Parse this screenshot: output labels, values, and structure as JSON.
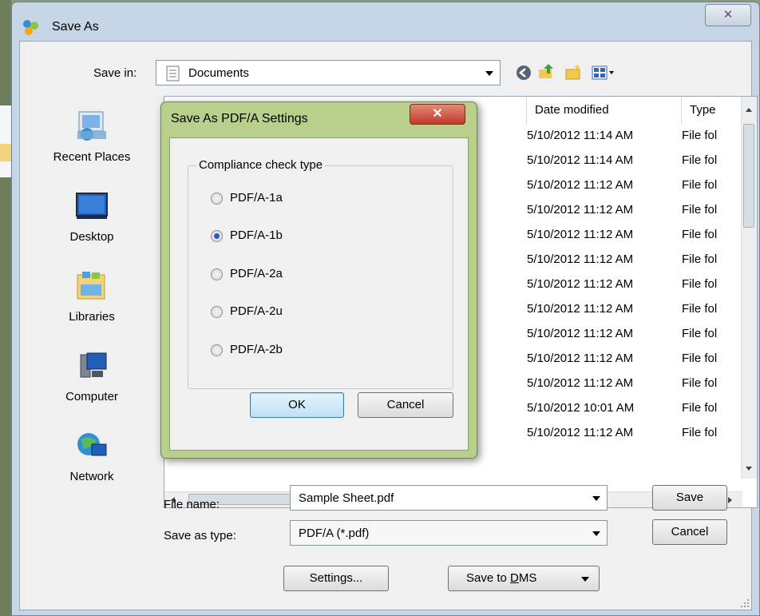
{
  "window": {
    "title": "Save As",
    "close_glyph": "✕"
  },
  "toolbar": {
    "save_in_label": "Save in:",
    "save_in_value": "Documents",
    "icons": [
      "back-icon",
      "up-folder-icon",
      "new-folder-icon",
      "view-menu-icon"
    ]
  },
  "places": [
    {
      "label": "Recent Places",
      "icon": "recent-places-icon"
    },
    {
      "label": "Desktop",
      "icon": "desktop-icon"
    },
    {
      "label": "Libraries",
      "icon": "libraries-icon"
    },
    {
      "label": "Computer",
      "icon": "computer-icon"
    },
    {
      "label": "Network",
      "icon": "network-icon"
    }
  ],
  "file_list": {
    "columns": [
      "Date modified",
      "Type"
    ],
    "rows": [
      {
        "date": "5/10/2012 11:14 AM",
        "type": "File fol"
      },
      {
        "date": "5/10/2012 11:14 AM",
        "type": "File fol"
      },
      {
        "date": "5/10/2012 11:12 AM",
        "type": "File fol"
      },
      {
        "date": "5/10/2012 11:12 AM",
        "type": "File fol"
      },
      {
        "date": "5/10/2012 11:12 AM",
        "type": "File fol"
      },
      {
        "date": "5/10/2012 11:12 AM",
        "type": "File fol"
      },
      {
        "date": "5/10/2012 11:12 AM",
        "type": "File fol"
      },
      {
        "date": "5/10/2012 11:12 AM",
        "type": "File fol"
      },
      {
        "date": "5/10/2012 11:12 AM",
        "type": "File fol"
      },
      {
        "date": "5/10/2012 11:12 AM",
        "type": "File fol"
      },
      {
        "date": "5/10/2012 11:12 AM",
        "type": "File fol"
      },
      {
        "date": "5/10/2012 10:01 AM",
        "type": "File fol"
      },
      {
        "date": "5/10/2012 11:12 AM",
        "type": "File fol"
      }
    ]
  },
  "form": {
    "file_name_label": "File name:",
    "file_name_value": "Sample Sheet.pdf",
    "save_type_label": "Save as type:",
    "save_type_value": "PDF/A (*.pdf)",
    "save_button": "Save",
    "cancel_button": "Cancel",
    "settings_button": "Settings...",
    "save_dms_prefix": "Save to ",
    "save_dms_accel": "D",
    "save_dms_rest": "MS"
  },
  "modal": {
    "title": "Save As PDF/A Settings",
    "close_glyph": "✕",
    "group_label": "Compliance check type",
    "options": [
      {
        "label": "PDF/A-1a",
        "selected": false
      },
      {
        "label": "PDF/A-1b",
        "selected": true
      },
      {
        "label": "PDF/A-2a",
        "selected": false
      },
      {
        "label": "PDF/A-2u",
        "selected": false
      },
      {
        "label": "PDF/A-2b",
        "selected": false
      }
    ],
    "ok_button": "OK",
    "cancel_button": "Cancel"
  },
  "colors": {
    "accent": "#2b5bb0",
    "modal_frame": "#b9cf8c",
    "window_frame": "#c6d6e6"
  }
}
